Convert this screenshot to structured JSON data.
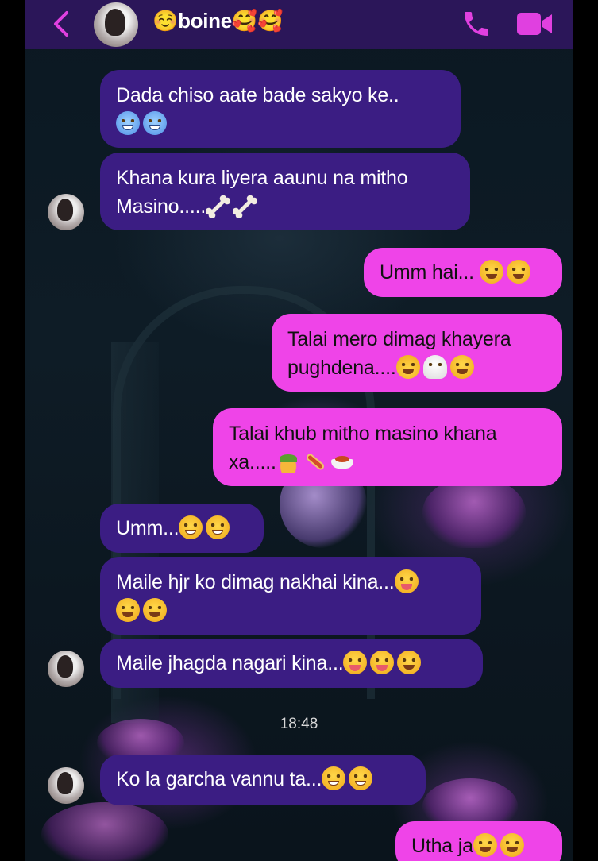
{
  "header": {
    "contact_name": "☺️boine🥰🥰",
    "back_icon": "chevron-left-icon",
    "call_icon": "phone-icon",
    "video_icon": "video-camera-icon",
    "accent_color": "#e040e0",
    "bar_color": "#2b1659"
  },
  "colors": {
    "incoming_bubble": "#3b1d83",
    "outgoing_bubble": "#ef44e8"
  },
  "messages": [
    {
      "direction": "in",
      "lines": [
        "Dada chiso aate bade sakyo ke..",
        ""
      ]
    },
    {
      "direction": "in",
      "lines": [
        "Khana kura liyera aaunu na mitho",
        "Masino....."
      ]
    },
    {
      "direction": "out",
      "lines": [
        "Umm hai..."
      ]
    },
    {
      "direction": "out",
      "lines": [
        "Talai mero dimag khayera",
        "pughdena...."
      ]
    },
    {
      "direction": "out",
      "lines": [
        "Talai khub mitho  masino khana",
        "xa....."
      ]
    },
    {
      "direction": "in",
      "lines": [
        "Umm..."
      ]
    },
    {
      "direction": "in",
      "lines": [
        "Maile hjr ko dimag nakhai kina...",
        ""
      ]
    },
    {
      "direction": "in",
      "lines": [
        "Maile jhagda nagari kina..."
      ]
    },
    {
      "direction": "in",
      "lines": [
        "Ko la garcha vannu ta..."
      ]
    },
    {
      "direction": "out",
      "lines": [
        "Utha  ja"
      ]
    }
  ],
  "timestamp": "18:48"
}
